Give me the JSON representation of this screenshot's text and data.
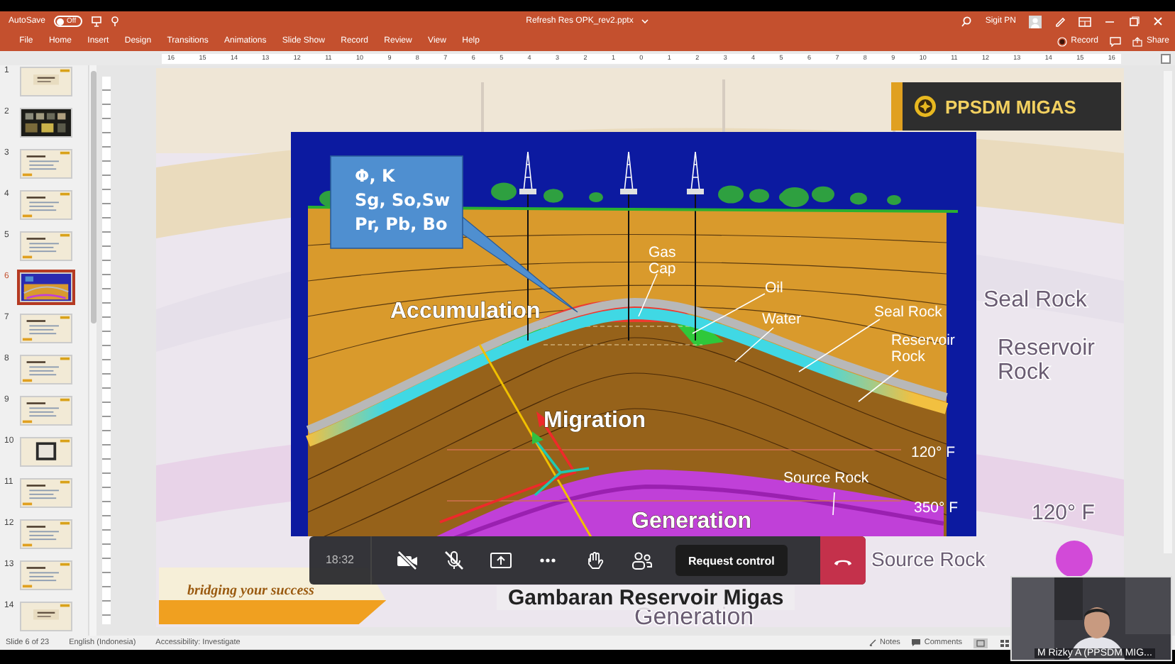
{
  "title_bar": {
    "autosave_label": "AutoSave",
    "autosave_state": "Off",
    "autosave_on": false,
    "document_title": "Refresh Res OPK_rev2.pptx",
    "user_name": "Sigit PN"
  },
  "ribbon_tabs": [
    "File",
    "Home",
    "Insert",
    "Design",
    "Transitions",
    "Animations",
    "Slide Show",
    "Record",
    "Review",
    "View",
    "Help"
  ],
  "ribbon_actions": {
    "record": "Record",
    "share": "Share"
  },
  "ruler_marks": [
    "16",
    "15",
    "14",
    "13",
    "12",
    "11",
    "10",
    "9",
    "8",
    "7",
    "6",
    "5",
    "4",
    "3",
    "2",
    "1",
    "0",
    "1",
    "2",
    "3",
    "4",
    "5",
    "6",
    "7",
    "8",
    "9",
    "10",
    "11",
    "12",
    "13",
    "14",
    "15",
    "16"
  ],
  "thumbnails": [
    {
      "number": "1",
      "kind": "title",
      "selected": false
    },
    {
      "number": "2",
      "selected": false
    },
    {
      "number": "3",
      "kind": "text",
      "selected": false
    },
    {
      "number": "4",
      "kind": "text",
      "selected": false
    },
    {
      "number": "5",
      "kind": "text",
      "selected": false
    },
    {
      "number": "6",
      "kind": "diagram",
      "selected": true
    },
    {
      "number": "7",
      "kind": "text",
      "selected": false
    },
    {
      "number": "8",
      "kind": "text",
      "selected": false
    },
    {
      "number": "9",
      "kind": "text",
      "selected": false
    },
    {
      "number": "10",
      "kind": "framed",
      "selected": false
    },
    {
      "number": "11",
      "kind": "text",
      "selected": false
    },
    {
      "number": "12",
      "kind": "text",
      "selected": false
    },
    {
      "number": "13",
      "kind": "text",
      "selected": false
    },
    {
      "number": "14",
      "kind": "title",
      "selected": false
    }
  ],
  "slide": {
    "logo_text": "PPSDM MIGAS",
    "tagline": "bridging your success",
    "caption": "Gambaran Reservoir Migas",
    "backdrop_labels": [
      {
        "lines": [
          "Seal Rock"
        ]
      },
      {
        "lines": [
          "Reservoir",
          "Rock"
        ]
      },
      {
        "lines": [
          "120° F"
        ]
      },
      {
        "lines": [
          "Source Rock"
        ]
      },
      {
        "lines": [
          "Generation"
        ]
      }
    ],
    "diagram": {
      "info_box": [
        "Φ, K",
        "Sg, So,Sw",
        "Pr, Pb, Bo"
      ],
      "labels": [
        {
          "kind": "minor",
          "lines": [
            "Gas",
            "Cap"
          ]
        },
        {
          "kind": "minor",
          "lines": [
            "Oil"
          ]
        },
        {
          "kind": "major",
          "lines": [
            "Accumulation"
          ]
        },
        {
          "kind": "minor",
          "lines": [
            "Seal Rock"
          ]
        },
        {
          "kind": "minor",
          "lines": [
            "Water"
          ]
        },
        {
          "kind": "minor",
          "lines": [
            "Reservoir",
            "Rock"
          ]
        },
        {
          "kind": "major",
          "lines": [
            "Migration"
          ]
        },
        {
          "kind": "minor",
          "lines": [
            "120° F"
          ]
        },
        {
          "kind": "minor",
          "lines": [
            "Source Rock"
          ]
        },
        {
          "kind": "minor",
          "lines": [
            "350° F"
          ]
        },
        {
          "kind": "major",
          "lines": [
            "Generation"
          ]
        }
      ]
    }
  },
  "call_toolbar": {
    "time": "18:32",
    "camera_on": false,
    "mic_on": false,
    "request_label": "Request control"
  },
  "status_bar": {
    "slide_info": "Slide 6 of 23",
    "language": "English (Indonesia)",
    "accessibility": "Accessibility: Investigate",
    "notes": "Notes",
    "comments": "Comments"
  },
  "video_tile": {
    "name": "M Rizky A (PPSDM MIG..."
  }
}
